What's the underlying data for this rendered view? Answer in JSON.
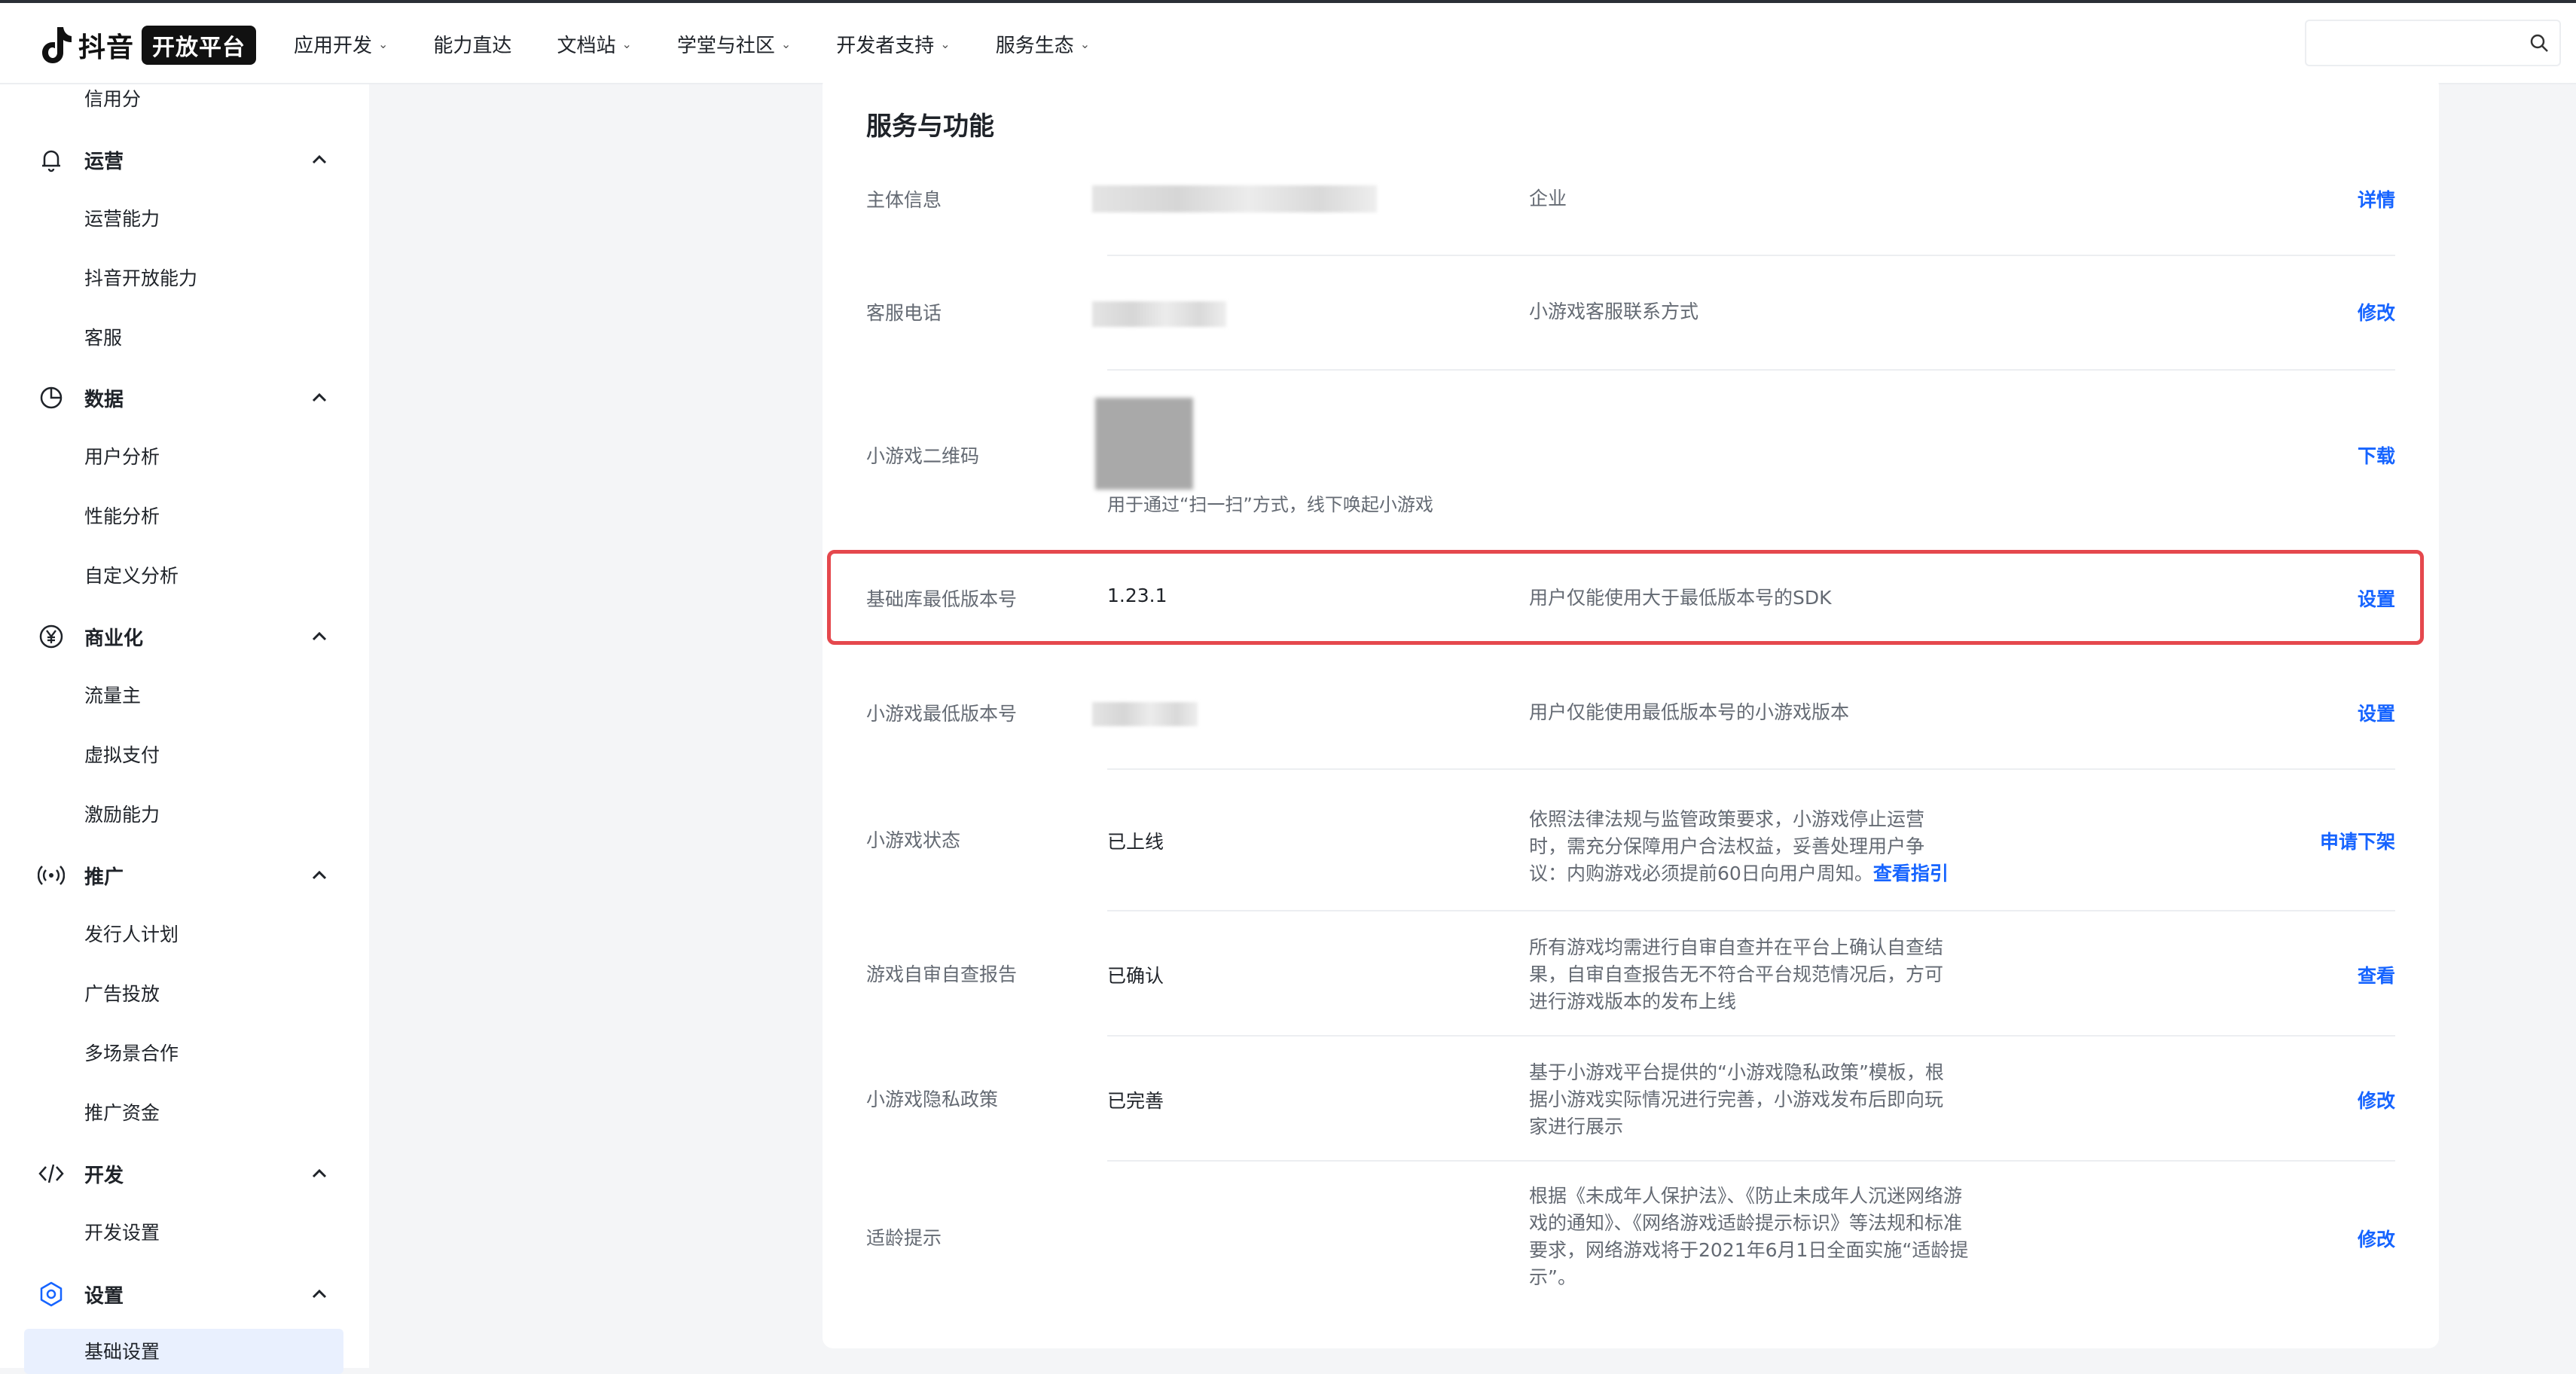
{
  "header": {
    "logo_text": "抖音",
    "logo_badge": "开放平台",
    "nav": [
      "应用开发",
      "能力直达",
      "文档站",
      "学堂与社区",
      "开发者支持",
      "服务生态"
    ],
    "nav_has_dropdown": [
      true,
      false,
      true,
      true,
      true,
      true
    ],
    "search_placeholder": ""
  },
  "sidebar": {
    "top_item": "信用分",
    "groups": [
      {
        "label": "运营",
        "icon": "bell-icon",
        "items": [
          "运营能力",
          "抖音开放能力",
          "客服"
        ]
      },
      {
        "label": "数据",
        "icon": "pie-chart-icon",
        "items": [
          "用户分析",
          "性能分析",
          "自定义分析"
        ]
      },
      {
        "label": "商业化",
        "icon": "yen-icon",
        "items": [
          "流量主",
          "虚拟支付",
          "激励能力"
        ]
      },
      {
        "label": "推广",
        "icon": "broadcast-icon",
        "items": [
          "发行人计划",
          "广告投放",
          "多场景合作",
          "推广资金"
        ]
      },
      {
        "label": "开发",
        "icon": "code-icon",
        "items": [
          "开发设置"
        ]
      },
      {
        "label": "设置",
        "icon": "settings-icon",
        "items": [
          "基础设置"
        ]
      }
    ],
    "active_item": "基础设置"
  },
  "main": {
    "title": "服务与功能",
    "rows": [
      {
        "label": "主体信息",
        "value": "",
        "desc": "企业",
        "action": "详情"
      },
      {
        "label": "客服电话",
        "value": "",
        "desc": "小游戏客服联系方式",
        "action": "修改"
      },
      {
        "label": "小游戏二维码",
        "value": "",
        "caption": "用于通过“扫一扫”方式，线下唤起小游戏",
        "desc": "",
        "action": "下载"
      },
      {
        "label": "基础库最低版本号",
        "value": "1.23.1",
        "desc": "用户仅能使用大于最低版本号的SDK",
        "action": "设置"
      },
      {
        "label": "小游戏最低版本号",
        "value": "",
        "desc": "用户仅能使用最低版本号的小游戏版本",
        "action": "设置"
      },
      {
        "label": "小游戏状态",
        "value": "已上线",
        "desc": "依照法律法规与监管政策要求，小游戏停止运营时，需充分保障用户合法权益，妥善处理用户争议：内购游戏必须提前60日向用户周知。",
        "desc_link": "查看指引",
        "action": "申请下架"
      },
      {
        "label": "游戏自审自查报告",
        "value": "已确认",
        "desc": "所有游戏均需进行自审自查并在平台上确认自查结果，自审自查报告无不符合平台规范情况后，方可进行游戏版本的发布上线",
        "action": "查看"
      },
      {
        "label": "小游戏隐私政策",
        "value": "已完善",
        "desc": "基于小游戏平台提供的“小游戏隐私政策”模板，根据小游戏实际情况进行完善，小游戏发布后即向玩家进行展示",
        "action": "修改"
      },
      {
        "label": "适龄提示",
        "value": "",
        "desc": "根据《未成年人保护法》、《防止未成年人沉迷网络游戏的通知》、《网络游戏适龄提示标识》等法规和标准要求，网络游戏将于2021年6月1日全面实施“适龄提示”。",
        "action": "修改"
      }
    ],
    "highlight_color": "#e5484d",
    "link_color": "#1664ff"
  }
}
